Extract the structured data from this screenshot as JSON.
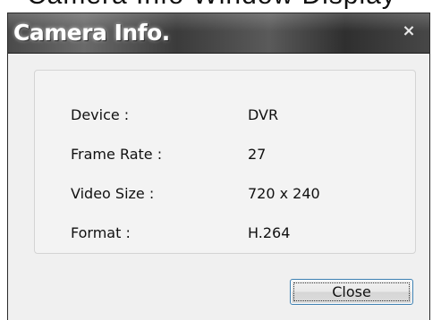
{
  "background": {
    "partial_text": "Camera Info Window Display"
  },
  "window": {
    "title": "Camera Info.",
    "close_glyph": "×"
  },
  "info": {
    "rows": [
      {
        "label": "Device :",
        "value": "DVR"
      },
      {
        "label": "Frame Rate :",
        "value": "27"
      },
      {
        "label": "Video Size :",
        "value": "720 x 240"
      },
      {
        "label": "Format :",
        "value": "H.264"
      }
    ]
  },
  "buttons": {
    "close_label": "Close"
  }
}
